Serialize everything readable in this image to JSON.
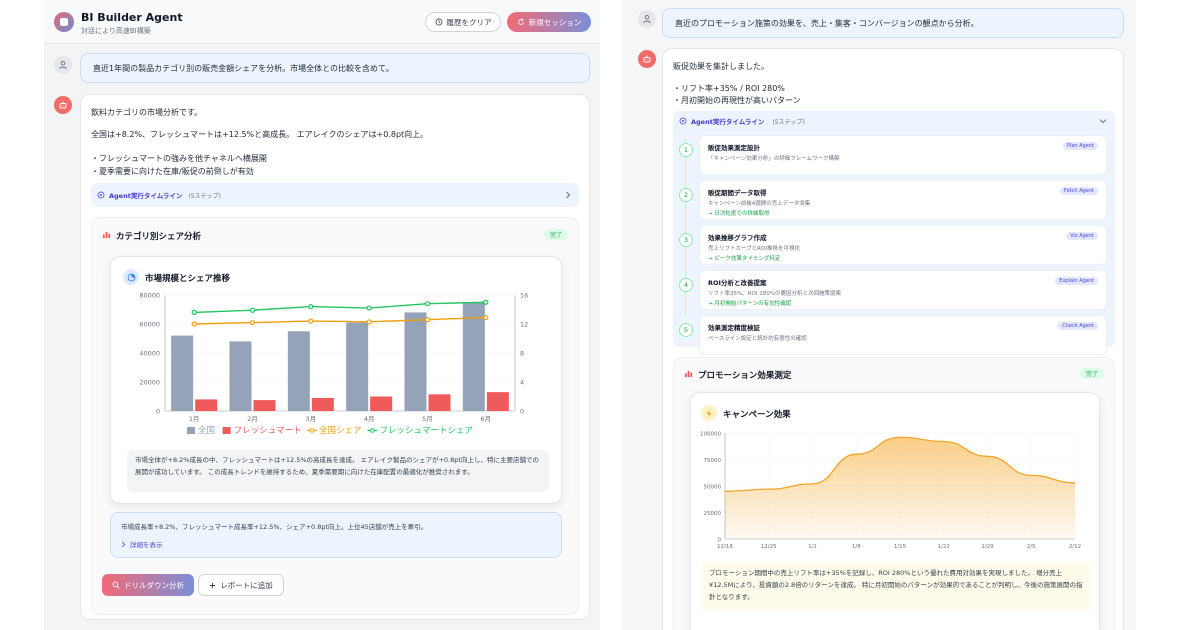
{
  "app": {
    "name": "BI Builder Agent",
    "subtitle": "対話により高速BI構築"
  },
  "header": {
    "clear_label": "履歴をクリア",
    "new_session_label": "新規セッション"
  },
  "left": {
    "user_message": "直近1年間の製品カテゴリ別の販売金額シェアを分析。市場全体との比較を含めて。",
    "bot_lines": [
      "飲料カテゴリの市場分析です。",
      "全国は+8.2%、フレッシュマートは+12.5%と高成長。 エアレイクのシェアは+0.8pt向上。",
      "・フレッシュマートの強みを他チャネルへ横展開",
      "・夏季需要に向けた在庫/販促の前倒しが有効"
    ],
    "timeline": {
      "label": "Agent実行タイムライン",
      "count": "(5ステップ)"
    },
    "section": {
      "title": "カテゴリ別シェア分析",
      "status": "完了"
    },
    "chart_card_title": "市場規模とシェア推移",
    "chart_summary": "市場全体が+8.2%成長の中、フレッシュマートは+12.5%の高成長を達成。 エアレイク製品のシェアが+0.8pt向上し、特に主要店舗での展開が成功しています。 この成長トレンドを維持するため、夏季需要期に向けた在庫配置の最適化が推奨されます。",
    "insight_text": "市場成長率+8.2%、フレッシュマート成長率+12.5%、シェア+0.8pt向上。上位45店舗が売上を牽引。",
    "insight_link": "詳細を表示",
    "drilldown_label": "ドリルダウン分析",
    "add_report_label": "レポートに追加"
  },
  "right": {
    "user_message": "直近のプロモーション施策の効果を、売上・集客・コンバージョンの観点から分析。",
    "bot_lines": [
      "販促効果を集計しました。",
      "・リフト率+35% / ROI 280%",
      "・月初開始の再現性が高いパターン"
    ],
    "timeline": {
      "label": "Agent実行タイムライン",
      "count": "(5ステップ)"
    },
    "steps": [
      {
        "num": "1",
        "title": "販促効果測定設計",
        "desc": "「キャンペーン効果分析」の評価フレームワーク構築",
        "result": "",
        "tag": "Plan Agent"
      },
      {
        "num": "2",
        "title": "販促期間データ取得",
        "desc": "キャンペーン前後4週間の売上データ収集",
        "result": "→ 日次粒度での詳細取得",
        "tag": "Fetch Agent"
      },
      {
        "num": "3",
        "title": "効果推移グラフ作成",
        "desc": "売上リフトカーブとROI推移を可視化",
        "result": "→ ピーク効果タイミング特定",
        "tag": "Viz Agent"
      },
      {
        "num": "4",
        "title": "ROI分析と改善提案",
        "desc": "リフト率35%、ROI 280%の要因分析と次回施策提案",
        "result": "→ 月初開始パターンの有効性確認",
        "tag": "Explain Agent"
      },
      {
        "num": "5",
        "title": "効果測定精度検証",
        "desc": "ベースライン設定と統計的有意性の確認",
        "result": "",
        "tag": "Check Agent"
      }
    ],
    "section": {
      "title": "プロモーション効果測定",
      "status": "完了"
    },
    "chart_card_title": "キャンペーン効果",
    "chart_summary": "プロモーション期間中の売上リフト率は+35%を記録し、ROI 280%という優れた費用対効果を実現しました。 増分売上¥12.5Mにより、投資額の2.8倍のリターンを達成。 特に月初開始のパターンが効果的であることが判明し、今後の施策展開の指針となります。"
  },
  "colors": {
    "bar_market": "#94a3b8",
    "bar_fresh": "#ef5a5a",
    "line_market": "#f59e0b",
    "line_fresh": "#22c55e",
    "area": "#f5a524"
  },
  "chart_data": [
    {
      "type": "bar",
      "title": "市場規模とシェア推移",
      "categories": [
        "1月",
        "2月",
        "3月",
        "4月",
        "5月",
        "6月"
      ],
      "ylim": [
        0,
        80000
      ],
      "y2lim": [
        0,
        16
      ],
      "yticks": [
        0,
        20000,
        40000,
        60000,
        80000
      ],
      "y2ticks": [
        0,
        4,
        8,
        12,
        16
      ],
      "series": [
        {
          "name": "全国",
          "kind": "bar",
          "axis": "left",
          "values": [
            52000,
            48000,
            55000,
            61000,
            68000,
            75000
          ]
        },
        {
          "name": "フレッシュマート",
          "kind": "bar",
          "axis": "left",
          "values": [
            8000,
            7500,
            9000,
            10000,
            11500,
            13000
          ]
        },
        {
          "name": "全国シェア",
          "kind": "line",
          "axis": "right",
          "values": [
            12.0,
            12.2,
            12.4,
            12.3,
            12.6,
            12.9
          ]
        },
        {
          "name": "フレッシュマートシェア",
          "kind": "line",
          "axis": "right",
          "values": [
            13.6,
            13.9,
            14.4,
            14.2,
            14.8,
            15.0
          ]
        }
      ],
      "legend": "bottom",
      "grid": true
    },
    {
      "type": "area",
      "title": "キャンペーン効果",
      "x": [
        "12/18",
        "12/25",
        "1/1",
        "1/8",
        "1/15",
        "1/22",
        "1/29",
        "2/5",
        "2/12"
      ],
      "values": [
        45000,
        47000,
        52000,
        80000,
        96000,
        92000,
        78000,
        60000,
        53000
      ],
      "ylim": [
        0,
        100000
      ],
      "yticks": [
        0,
        25000,
        50000,
        75000,
        100000
      ],
      "grid": true
    }
  ]
}
